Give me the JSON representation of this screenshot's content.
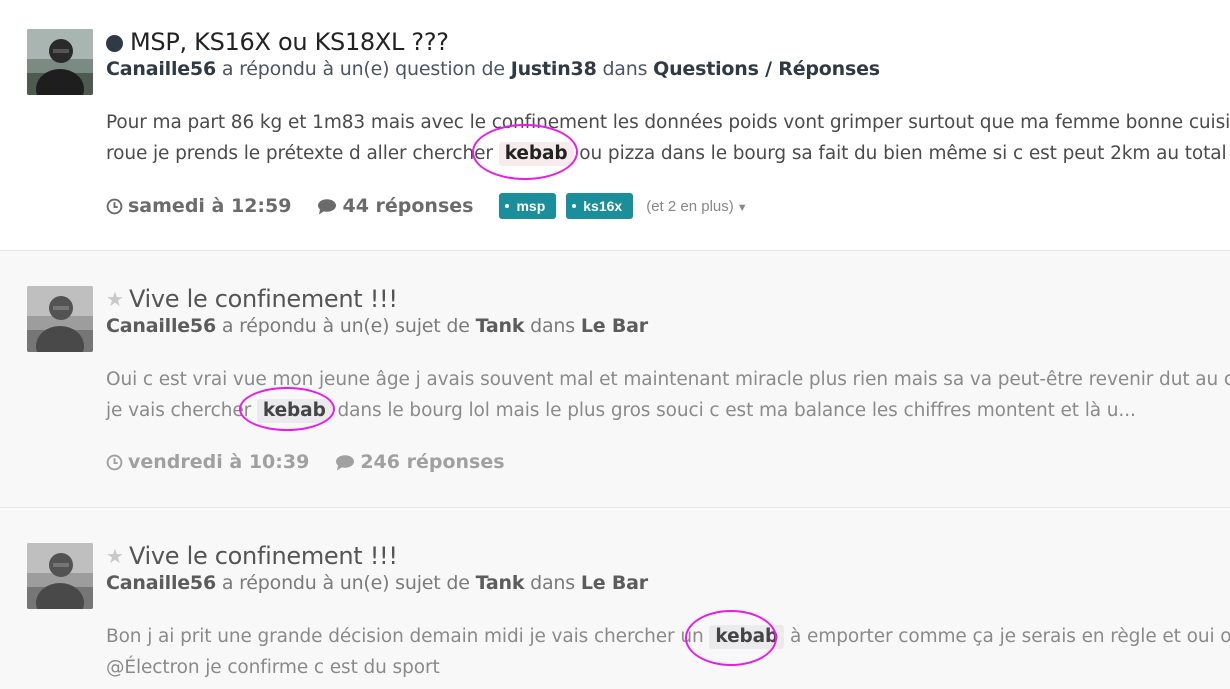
{
  "results": [
    {
      "title": "MSP, KS16X ou KS18XL ???",
      "author": "Canaille56",
      "action": "a répondu à un(e) question de",
      "target_user": "Justin38",
      "in_word": "dans",
      "forum": "Questions / Réponses",
      "snippet_l1": "Pour ma part 86 kg et 1m83 mais avec le confinement les données poids vont grimper surtout que ma femme bonne cuisinière",
      "snippet_l2_pre": "roue je prends le prétexte d aller chercher",
      "highlight": "kebab",
      "snippet_l2_post": "ou pizza dans le bourg sa fait du bien même si c est peut 2km au total",
      "date": "samedi à 12:59",
      "replies": "44 réponses",
      "tags": [
        "msp",
        "ks16x"
      ],
      "more_tags": "(et 2 en plus)"
    },
    {
      "title": "Vive le confinement !!!",
      "author": "Canaille56",
      "action": "a répondu à un(e) sujet de",
      "target_user": "Tank",
      "in_word": "dans",
      "forum": "Le Bar",
      "snippet_l1": "Oui c est vrai vue mon jeune âge j avais souvent mal et maintenant miracle plus rien mais sa va peut-être revenir dut au confinement",
      "snippet_l2_pre": "je vais chercher",
      "highlight": "kebab",
      "snippet_l2_post": "dans le bourg lol mais le plus gros souci c est ma balance les chiffres montent et là u...",
      "date": "vendredi à 10:39",
      "replies": "246 réponses"
    },
    {
      "title": "Vive le confinement !!!",
      "author": "Canaille56",
      "action": "a répondu à un(e) sujet de",
      "target_user": "Tank",
      "in_word": "dans",
      "forum": "Le Bar",
      "snippet_l1_pre": "Bon j ai prit une grande décision demain midi je vais chercher un",
      "highlight": "kebab",
      "snippet_l1_post": "à emporter comme ça je serais en règle et oui on va",
      "snippet_l2": "@Électron je confirme c est du sport"
    }
  ],
  "colors": {
    "tag_bg": "#1a8e9a",
    "annotation_circle": "#e81ce8",
    "unread_dot": "#2f3a45"
  }
}
